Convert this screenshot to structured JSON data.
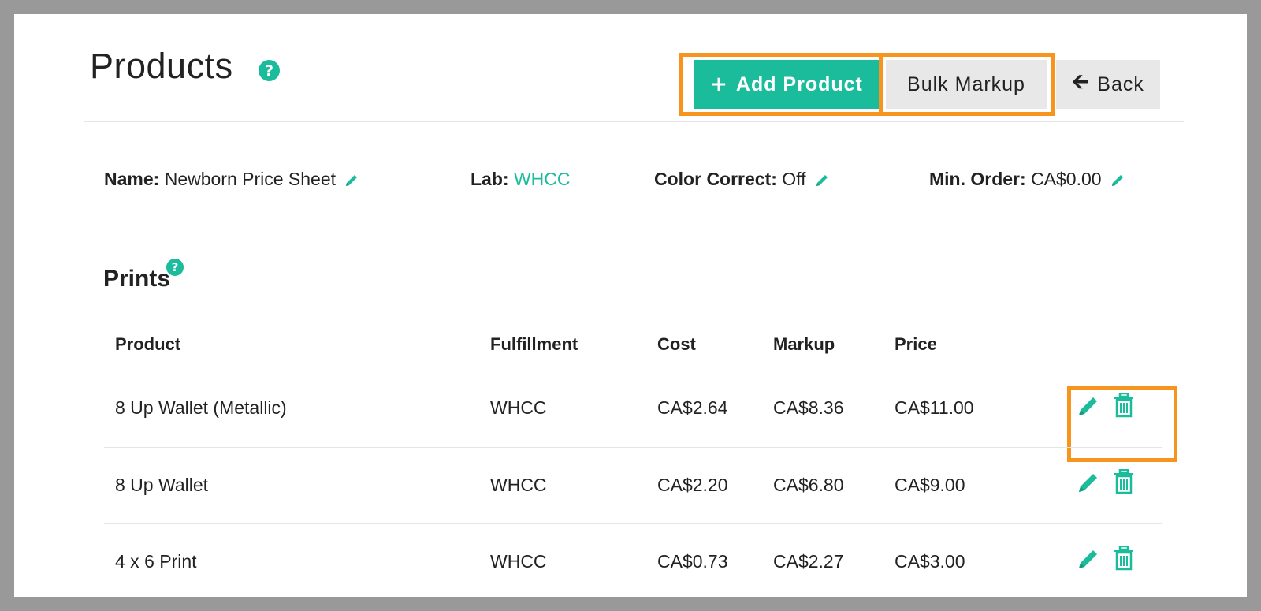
{
  "header": {
    "title": "Products",
    "add_product_label": "Add Product",
    "bulk_markup_label": "Bulk Markup",
    "back_label": "Back"
  },
  "meta": {
    "name_label": "Name:",
    "name_value": "Newborn Price Sheet",
    "lab_label": "Lab:",
    "lab_value": "WHCC",
    "color_correct_label": "Color Correct:",
    "color_correct_value": "Off",
    "min_order_label": "Min. Order:",
    "min_order_value": "CA$0.00"
  },
  "section": {
    "title": "Prints"
  },
  "table": {
    "columns": [
      "Product",
      "Fulfillment",
      "Cost",
      "Markup",
      "Price"
    ],
    "rows": [
      [
        "8 Up Wallet (Metallic)",
        "WHCC",
        "CA$2.64",
        "CA$8.36",
        "CA$11.00"
      ],
      [
        "8 Up Wallet",
        "WHCC",
        "CA$2.20",
        "CA$6.80",
        "CA$9.00"
      ],
      [
        "4 x 6 Print",
        "WHCC",
        "CA$0.73",
        "CA$2.27",
        "CA$3.00"
      ]
    ]
  },
  "icons": {
    "help": "help-icon",
    "edit": "pencil-icon",
    "delete": "trash-icon",
    "back": "arrow-left-icon",
    "add": "plus-icon"
  },
  "colors": {
    "accent": "#1bbc9b",
    "highlight": "#f7941d",
    "button_gray": "#e8e8e8",
    "frame": "#999999"
  }
}
